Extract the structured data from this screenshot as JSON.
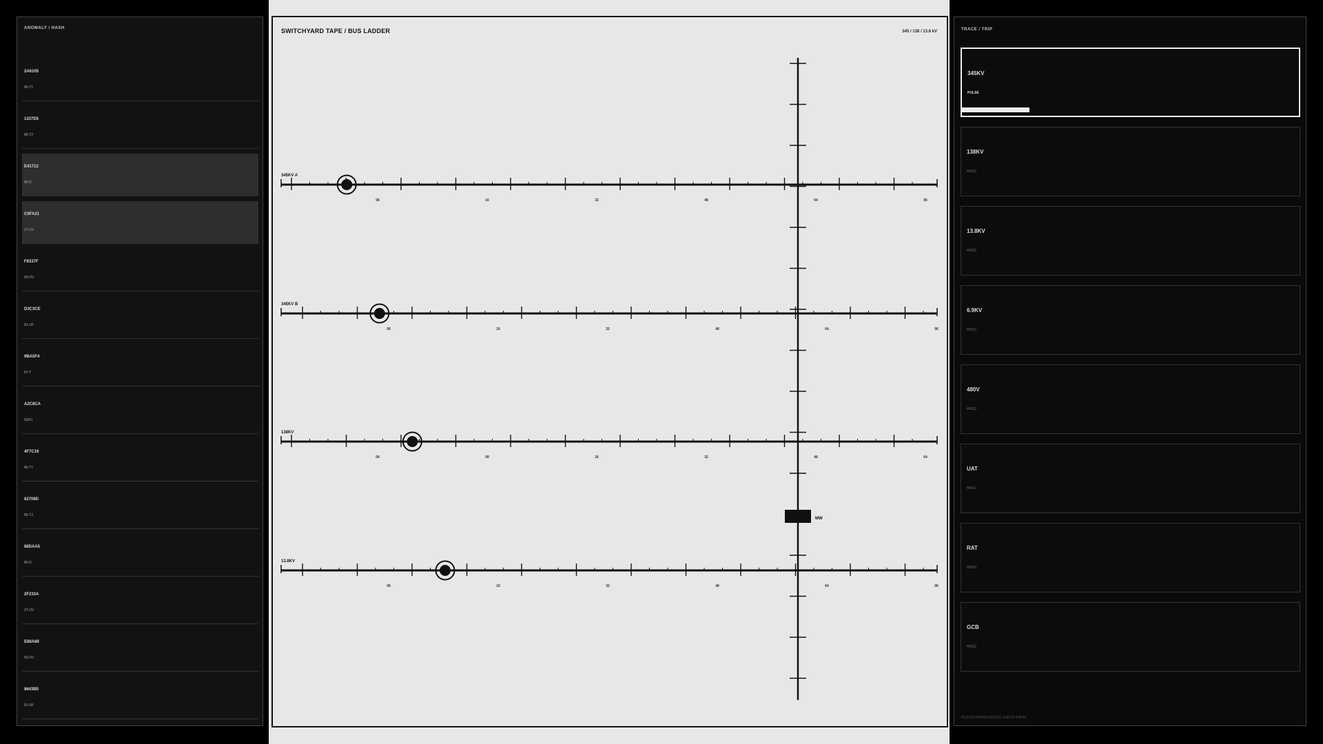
{
  "left": {
    "header": "ANOMALY / HASH",
    "rows": [
      {
        "hash": "2A6105",
        "code": "86-T1",
        "selected": false
      },
      {
        "hash": "1337D5",
        "code": "86-T2",
        "selected": false
      },
      {
        "hash": "E41712",
        "code": "86-D",
        "selected": true
      },
      {
        "hash": "C0FA21",
        "code": "27-UV",
        "selected": true
      },
      {
        "hash": "F8337F",
        "code": "59-OV",
        "selected": false
      },
      {
        "hash": "D3C3CE",
        "code": "81-UF",
        "selected": false
      },
      {
        "hash": "9BA5F4",
        "code": "87-T",
        "selected": false
      },
      {
        "hash": "A2C8CA",
        "code": "50/51",
        "selected": false
      },
      {
        "hash": "4F7C16",
        "code": "86-T1",
        "selected": false
      },
      {
        "hash": "62708D",
        "code": "86-T2",
        "selected": false
      },
      {
        "hash": "88DAA5",
        "code": "86-D",
        "selected": false
      },
      {
        "hash": "2F233A",
        "code": "27-UV",
        "selected": false
      },
      {
        "hash": "E88A88",
        "code": "59-OV",
        "selected": false
      },
      {
        "hash": "8643B5",
        "code": "81-UF",
        "selected": false
      }
    ]
  },
  "center": {
    "title": "SWITCHYARD TAPE / BUS LADDER",
    "readout": "345 / 138 / 13.8 kV",
    "buses": [
      {
        "label": "345KV A",
        "ticks": [
          "08",
          "16",
          "32",
          "48",
          "64",
          "96"
        ],
        "marker": 0.1
      },
      {
        "label": "345KV B",
        "ticks": [
          "08",
          "16",
          "32",
          "48",
          "64",
          "96"
        ],
        "marker": 0.15
      },
      {
        "label": "138KV",
        "ticks": [
          "08",
          "08",
          "16",
          "32",
          "48",
          "64"
        ],
        "marker": 0.2
      },
      {
        "label": "13.8KV",
        "ticks": [
          "08",
          "16",
          "32",
          "48",
          "64",
          "96"
        ],
        "marker": 0.25
      }
    ],
    "mw_label": "MW"
  },
  "right": {
    "header": "TRACE / TRIP",
    "cards": [
      {
        "name": "345KV",
        "state": "PULSE",
        "active": true,
        "level": 0.2
      },
      {
        "name": "138KV",
        "state": "HOLD",
        "active": false
      },
      {
        "name": "13.8KV",
        "state": "HOLD",
        "active": false
      },
      {
        "name": "6.9KV",
        "state": "HOLD",
        "active": false
      },
      {
        "name": "480V",
        "state": "HOLD",
        "active": false
      },
      {
        "name": "UAT",
        "state": "HOLD",
        "active": false
      },
      {
        "name": "RAT",
        "state": "HOLD",
        "active": false
      },
      {
        "name": "GCB",
        "state": "HOLD",
        "active": false
      }
    ],
    "footer": "HUD/SCHWARZWEISS 14B/18 FIBRE"
  },
  "colors": {
    "tape_bg": "#e7e8e6",
    "ink": "#111111",
    "panel_bg": "#121212",
    "highlight": "#2e2e2e"
  }
}
